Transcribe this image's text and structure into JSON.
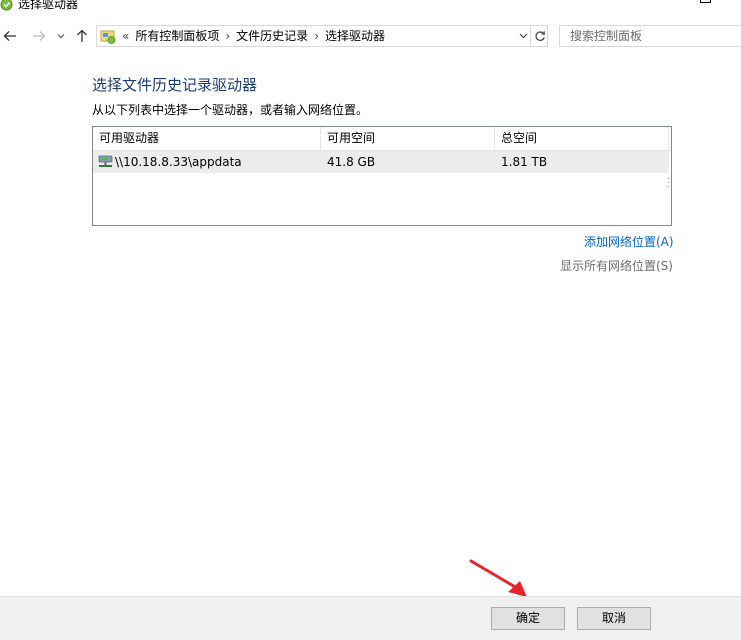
{
  "window": {
    "title": "选择驱动器"
  },
  "address_bar": {
    "prefix": "«",
    "crumbs": [
      "所有控制面板项",
      "文件历史记录",
      "选择驱动器"
    ]
  },
  "search": {
    "placeholder": "搜索控制面板"
  },
  "main": {
    "heading": "选择文件历史记录驱动器",
    "instruction": "从以下列表中选择一个驱动器，或者输入网络位置。"
  },
  "drive_list": {
    "columns": [
      "可用驱动器",
      "可用空间",
      "总空间"
    ],
    "rows": [
      {
        "name": "\\\\10.18.8.33\\appdata",
        "free": "41.8 GB",
        "total": "1.81 TB"
      }
    ]
  },
  "links": {
    "add_network": "添加网络位置(A)",
    "show_all_network": "显示所有网络位置(S)"
  },
  "buttons": {
    "ok": "确定",
    "cancel": "取消"
  },
  "colors": {
    "heading": "#1e3c78",
    "link": "#0066cc",
    "link_disabled": "#6d6d6d",
    "annotation_arrow": "#e8232a",
    "selected_row": "#ececec",
    "bottom_bar": "#f0f0f0"
  },
  "icons": {
    "title": "file-history-icon",
    "back": "arrow-left-icon",
    "forward": "arrow-right-icon",
    "recent": "chevron-down-icon",
    "up": "arrow-up-icon",
    "address": "control-panel-icon",
    "dropdown": "chevron-down-icon",
    "refresh": "refresh-icon",
    "drive": "network-drive-icon"
  }
}
